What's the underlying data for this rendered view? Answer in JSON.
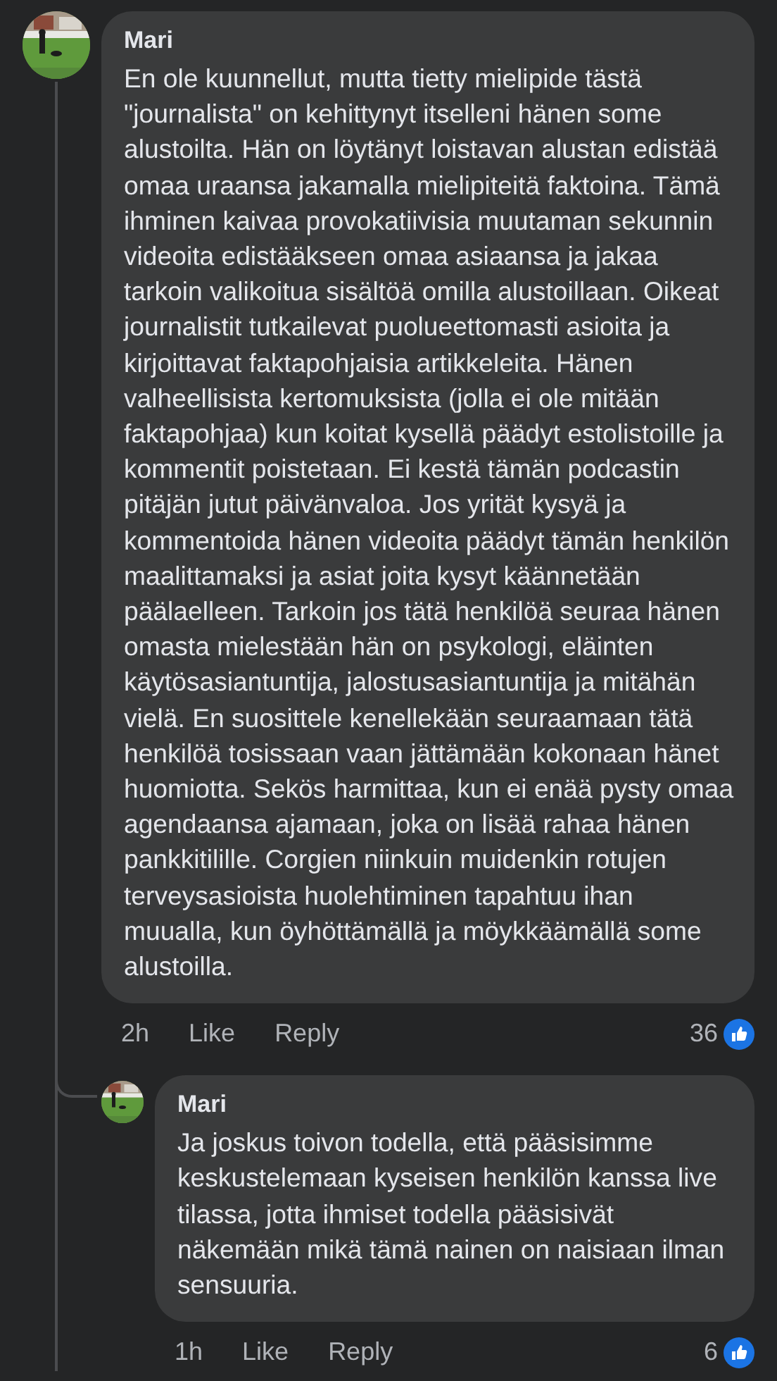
{
  "comments": [
    {
      "author": "Mari",
      "text": "En ole kuunnellut, mutta tietty mielipide tästä \"journalista\" on kehittynyt itselleni hänen some alustoilta. Hän on löytänyt loistavan alustan edistää omaa uraansa jakamalla mielipiteitä faktoina. Tämä ihminen kaivaa provokatiivisia muutaman sekunnin videoita edistääkseen omaa asiaansa ja jakaa tarkoin valikoitua sisältöä omilla alustoillaan. Oikeat journalistit tutkailevat puolueettomasti asioita ja kirjoittavat faktapohjaisia artikkeleita. Hänen valheellisista kertomuksista (jolla ei ole mitään faktapohjaa) kun koitat kysellä päädyt estolistoille ja kommentit poistetaan. Ei kestä tämän podcastin pitäjän jutut päivänvaloa. Jos yrität kysyä ja kommentoida hänen videoita päädyt tämän henkilön maalittamaksi ja asiat joita kysyt käännetään päälaelleen. Tarkoin jos tätä henkilöä seuraa hänen omasta mielestään hän on psykologi, eläinten käytösasiantuntija, jalostusasiantuntija ja mitähän vielä. En suosittele kenellekään seuraamaan tätä henkilöä tosissaan vaan jättämään kokonaan hänet huomiotta. Sekös harmittaa, kun ei enää pysty omaa agendaansa ajamaan, joka on lisää rahaa hänen pankkitilille. Corgien niinkuin muidenkin rotujen terveysasioista huolehtiminen tapahtuu ihan muualla, kun öyhöttämällä ja möykkäämällä some alustoilla.",
      "time": "2h",
      "like": "Like",
      "reply": "Reply",
      "reactions": "36",
      "replies": [
        {
          "author": "Mari",
          "text": "Ja joskus toivon todella, että pääsisimme keskustelemaan kyseisen henkilön kanssa live tilassa, jotta ihmiset todella pääsisivät näkemään mikä tämä nainen on naisiaan ilman sensuuria.",
          "time": "1h",
          "like": "Like",
          "reply": "Reply",
          "reactions": "6"
        }
      ]
    }
  ]
}
